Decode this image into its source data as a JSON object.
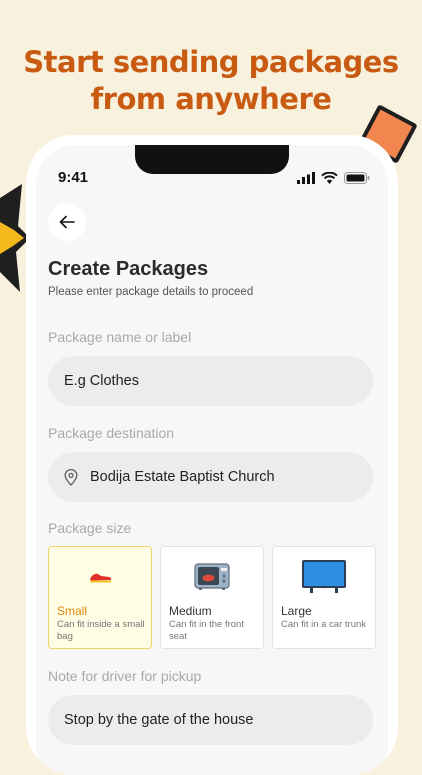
{
  "promo": {
    "headline_line1": "Start sending packages",
    "headline_line2": "from anywhere",
    "headline_color": "#c85a12",
    "background_color": "#f8f1de"
  },
  "status_bar": {
    "time": "9:41",
    "icons": [
      "signal-icon",
      "wifi-icon",
      "battery-icon"
    ]
  },
  "header": {
    "back_icon": "arrow-left-icon",
    "title": "Create Packages",
    "subtitle": "Please enter package details to proceed"
  },
  "form": {
    "package_name": {
      "label": "Package name or label",
      "placeholder": "E.g Clothes"
    },
    "destination": {
      "label": "Package destination",
      "value": "Bodija Estate Baptist Church",
      "icon": "location-pin-icon"
    },
    "package_size": {
      "label": "Package size",
      "selected": "Small",
      "options": [
        {
          "name": "Small",
          "desc": "Can fit inside a small bag",
          "icon": "shoe-icon"
        },
        {
          "name": "Medium",
          "desc": "Can fit in the front seat",
          "icon": "microwave-icon"
        },
        {
          "name": "Large",
          "desc": "Can fit in a car trunk",
          "icon": "tv-icon"
        }
      ],
      "selected_color": "#d9880d"
    },
    "driver_note": {
      "label": "Note for driver for pickup",
      "value": "Stop by the gate of the house"
    }
  }
}
